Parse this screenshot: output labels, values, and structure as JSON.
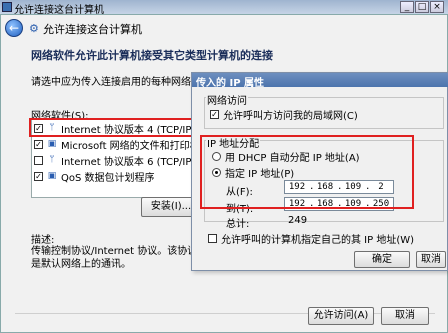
{
  "window": {
    "title": "允许连接这台计算机"
  },
  "header": {
    "title": "允许连接这台计算机"
  },
  "main": {
    "heading": "网络软件允许此计算机接受其它类型计算机的连接",
    "instructions": "请选中应为传入连接启用的每种网络软件类",
    "network_software_label": "网络软件(S):",
    "items": [
      {
        "label": "Internet 协议版本 4 (TCP/IPv4)",
        "checked": true,
        "selected": true
      },
      {
        "label": "Microsoft 网络的文件和打印机共享",
        "checked": true,
        "selected": false
      },
      {
        "label": "Internet 协议版本 6 (TCP/IPv6)",
        "checked": false,
        "selected": false
      },
      {
        "label": "QoS 数据包计划程序",
        "checked": true,
        "selected": false
      }
    ],
    "install_button": "安装(I)...",
    "description_label": "描述:",
    "description_text": "传输控制协议/Internet 协议。该协议是默认网络上的通讯。"
  },
  "footer": {
    "allow_button": "允许访问(A)",
    "cancel_button": "取消"
  },
  "dialog": {
    "title": "传入的 IP 属性",
    "network_access_group": "网络访问",
    "allow_lan_checkbox": "允许呼叫方访问我的局域网(C)",
    "ip_assign_group": "IP 地址分配",
    "dhcp_radio": "用 DHCP 自动分配 IP 地址(A)",
    "specify_radio": "指定 IP 地址(P)",
    "from_label": "从(F):",
    "from_ip": [
      "192",
      "168",
      "109",
      "2"
    ],
    "to_label": "到(T):",
    "to_ip": [
      "192",
      "168",
      "109",
      "250"
    ],
    "total_label": "总计:",
    "total_value": "249",
    "allow_specify_checkbox": "允许呼叫的计算机指定自己的其 IP 地址(W)",
    "ok_button": "确定",
    "cancel_button": "取消"
  },
  "colors": {
    "highlight": "#e02020",
    "title_blue": "#4d74ad"
  }
}
